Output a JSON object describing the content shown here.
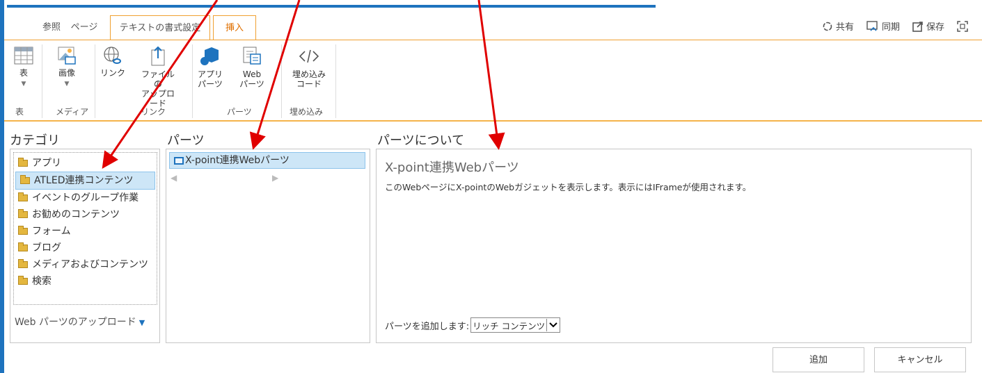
{
  "tabs": [
    "参照",
    "ページ",
    "テキストの書式設定",
    "挿入"
  ],
  "top_actions": {
    "share": "共有",
    "sync": "同期",
    "save": "保存"
  },
  "ribbon": {
    "table": "表",
    "image": "画像",
    "link": "リンク",
    "file_upload_1": "ファイルの",
    "file_upload_2": "アップロード",
    "app_parts_1": "アプリ",
    "app_parts_2": "パーツ",
    "web_parts_1": "Web",
    "web_parts_2": "パーツ",
    "embed_1": "埋め込み",
    "embed_2": "コード",
    "groups": {
      "table": "表",
      "media": "メディア",
      "link": "リンク",
      "parts": "パーツ",
      "embed": "埋め込み"
    }
  },
  "headers": {
    "category": "カテゴリ",
    "parts": "パーツ",
    "about": "パーツについて"
  },
  "categories": [
    "アプリ",
    "ATLED連携コンテンツ",
    "イベントのグループ作業",
    "お勧めのコンテンツ",
    "フォーム",
    "ブログ",
    "メディアおよびコンテンツ",
    "検索"
  ],
  "upload_link": "Web パーツのアップロード",
  "part_item": "X-point連携Webパーツ",
  "about": {
    "title": "X-point連携Webパーツ",
    "description": "このWebページにX-pointのWebガジェットを表示します。表示にはIFrameが使用されます。",
    "add_label": "パーツを追加します:",
    "add_value": "リッチ コンテンツ"
  },
  "buttons": {
    "add": "追加",
    "cancel": "キャンセル"
  },
  "colors": {
    "accent_orange": "#f0a030",
    "selection": "#cde6f7",
    "arrow_red": "#e00000",
    "brand_blue": "#1e73be"
  }
}
